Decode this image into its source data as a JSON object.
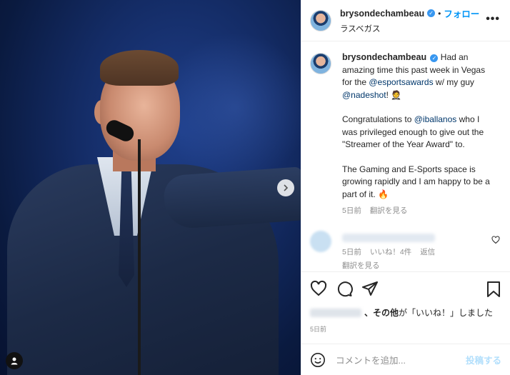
{
  "header": {
    "username": "brysondechambeau",
    "follow_label": "フォロー",
    "location": "ラスベガス",
    "more_label": "•••"
  },
  "caption": {
    "username": "brysondechambeau",
    "line1_a": "Had an amazing time this past week in Vegas for the ",
    "mention1": "@esportsawards",
    "line1_b": " w/ my guy ",
    "mention2": "@nadeshot",
    "line1_c": "! 🤵",
    "para2_a": "Congratulations to ",
    "mention3": "@iballanos",
    "para2_b": " who I was privileged enough to give out the \"Streamer of the Year Award\" to.",
    "para3": "The Gaming and E-Sports space is growing rapidly and I am happy to be a part of it. 🔥",
    "time": "5日前",
    "translate": "翻訳を見る"
  },
  "reply": {
    "time": "5日前",
    "likes": "いいね！4件",
    "reply_label": "返信",
    "translate": "翻訳を見る"
  },
  "likes_line": {
    "text_bold": "、その他",
    "text_rest": "が「いいね！」しました"
  },
  "post_time": "5日前",
  "add_comment": {
    "placeholder": "コメントを追加...",
    "post_label": "投稿する"
  },
  "icons": {
    "heart": "heart-icon",
    "comment": "comment-icon",
    "share": "paper-plane-icon",
    "bookmark": "bookmark-icon",
    "emoji": "smiley-icon"
  },
  "colors": {
    "accent": "#0095f6",
    "mention": "#00376b",
    "muted": "#8e8e8e"
  }
}
